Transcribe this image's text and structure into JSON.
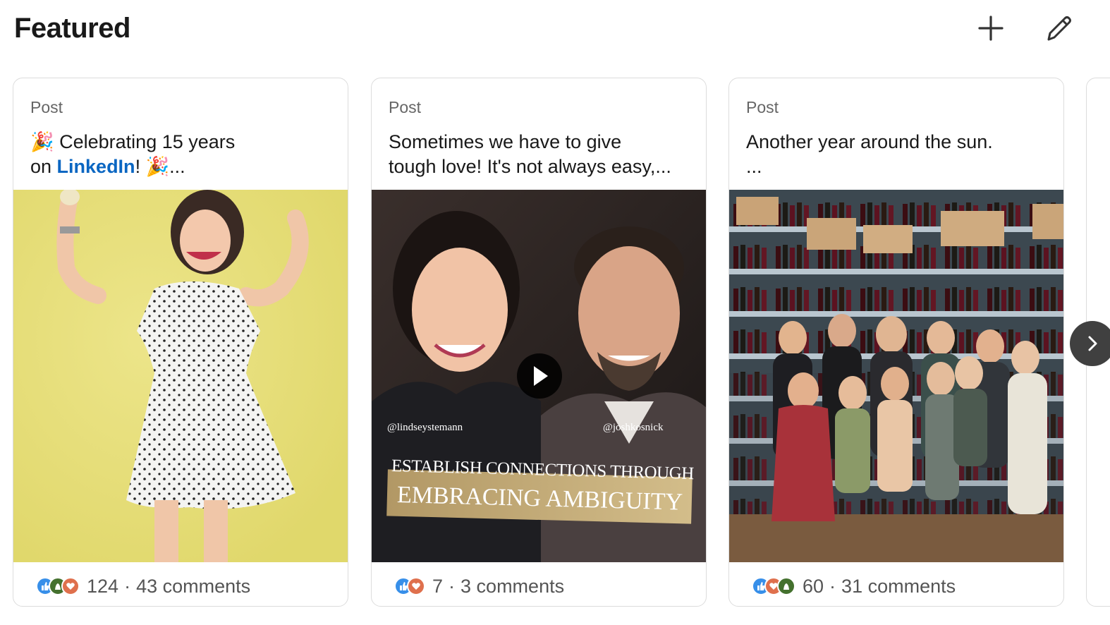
{
  "section": {
    "title": "Featured",
    "add_icon": "plus-icon",
    "edit_icon": "pencil-icon"
  },
  "cards": [
    {
      "kind": "Post",
      "text_before": "🎉 Celebrating 15 years\non ",
      "text_link": "LinkedIn",
      "text_after": "! 🎉...",
      "reaction_count": "124",
      "separator": "·",
      "comments": "43 comments",
      "reactions": [
        "like",
        "celebrate",
        "love"
      ]
    },
    {
      "kind": "Post",
      "text": "Sometimes we have to give\ntough love! It's not always easy,...",
      "reaction_count": "7",
      "separator": "·",
      "comments": "3 comments",
      "reactions": [
        "like",
        "love"
      ],
      "media": {
        "handle_left": "@lindseystemann",
        "handle_right": "@joshkosnick",
        "headline_1": "ESTABLISH CONNECTIONS THROUGH",
        "headline_2": "EMBRACING AMBIGUITY"
      }
    },
    {
      "kind": "Post",
      "text": "Another year around the sun.\n...",
      "reaction_count": "60",
      "separator": "·",
      "comments": "31 comments",
      "reactions": [
        "like",
        "love",
        "celebrate"
      ]
    }
  ],
  "colors": {
    "link": "#0a66c2",
    "like": "#378fe9",
    "celebrate": "#44712e",
    "love": "#df704d"
  }
}
